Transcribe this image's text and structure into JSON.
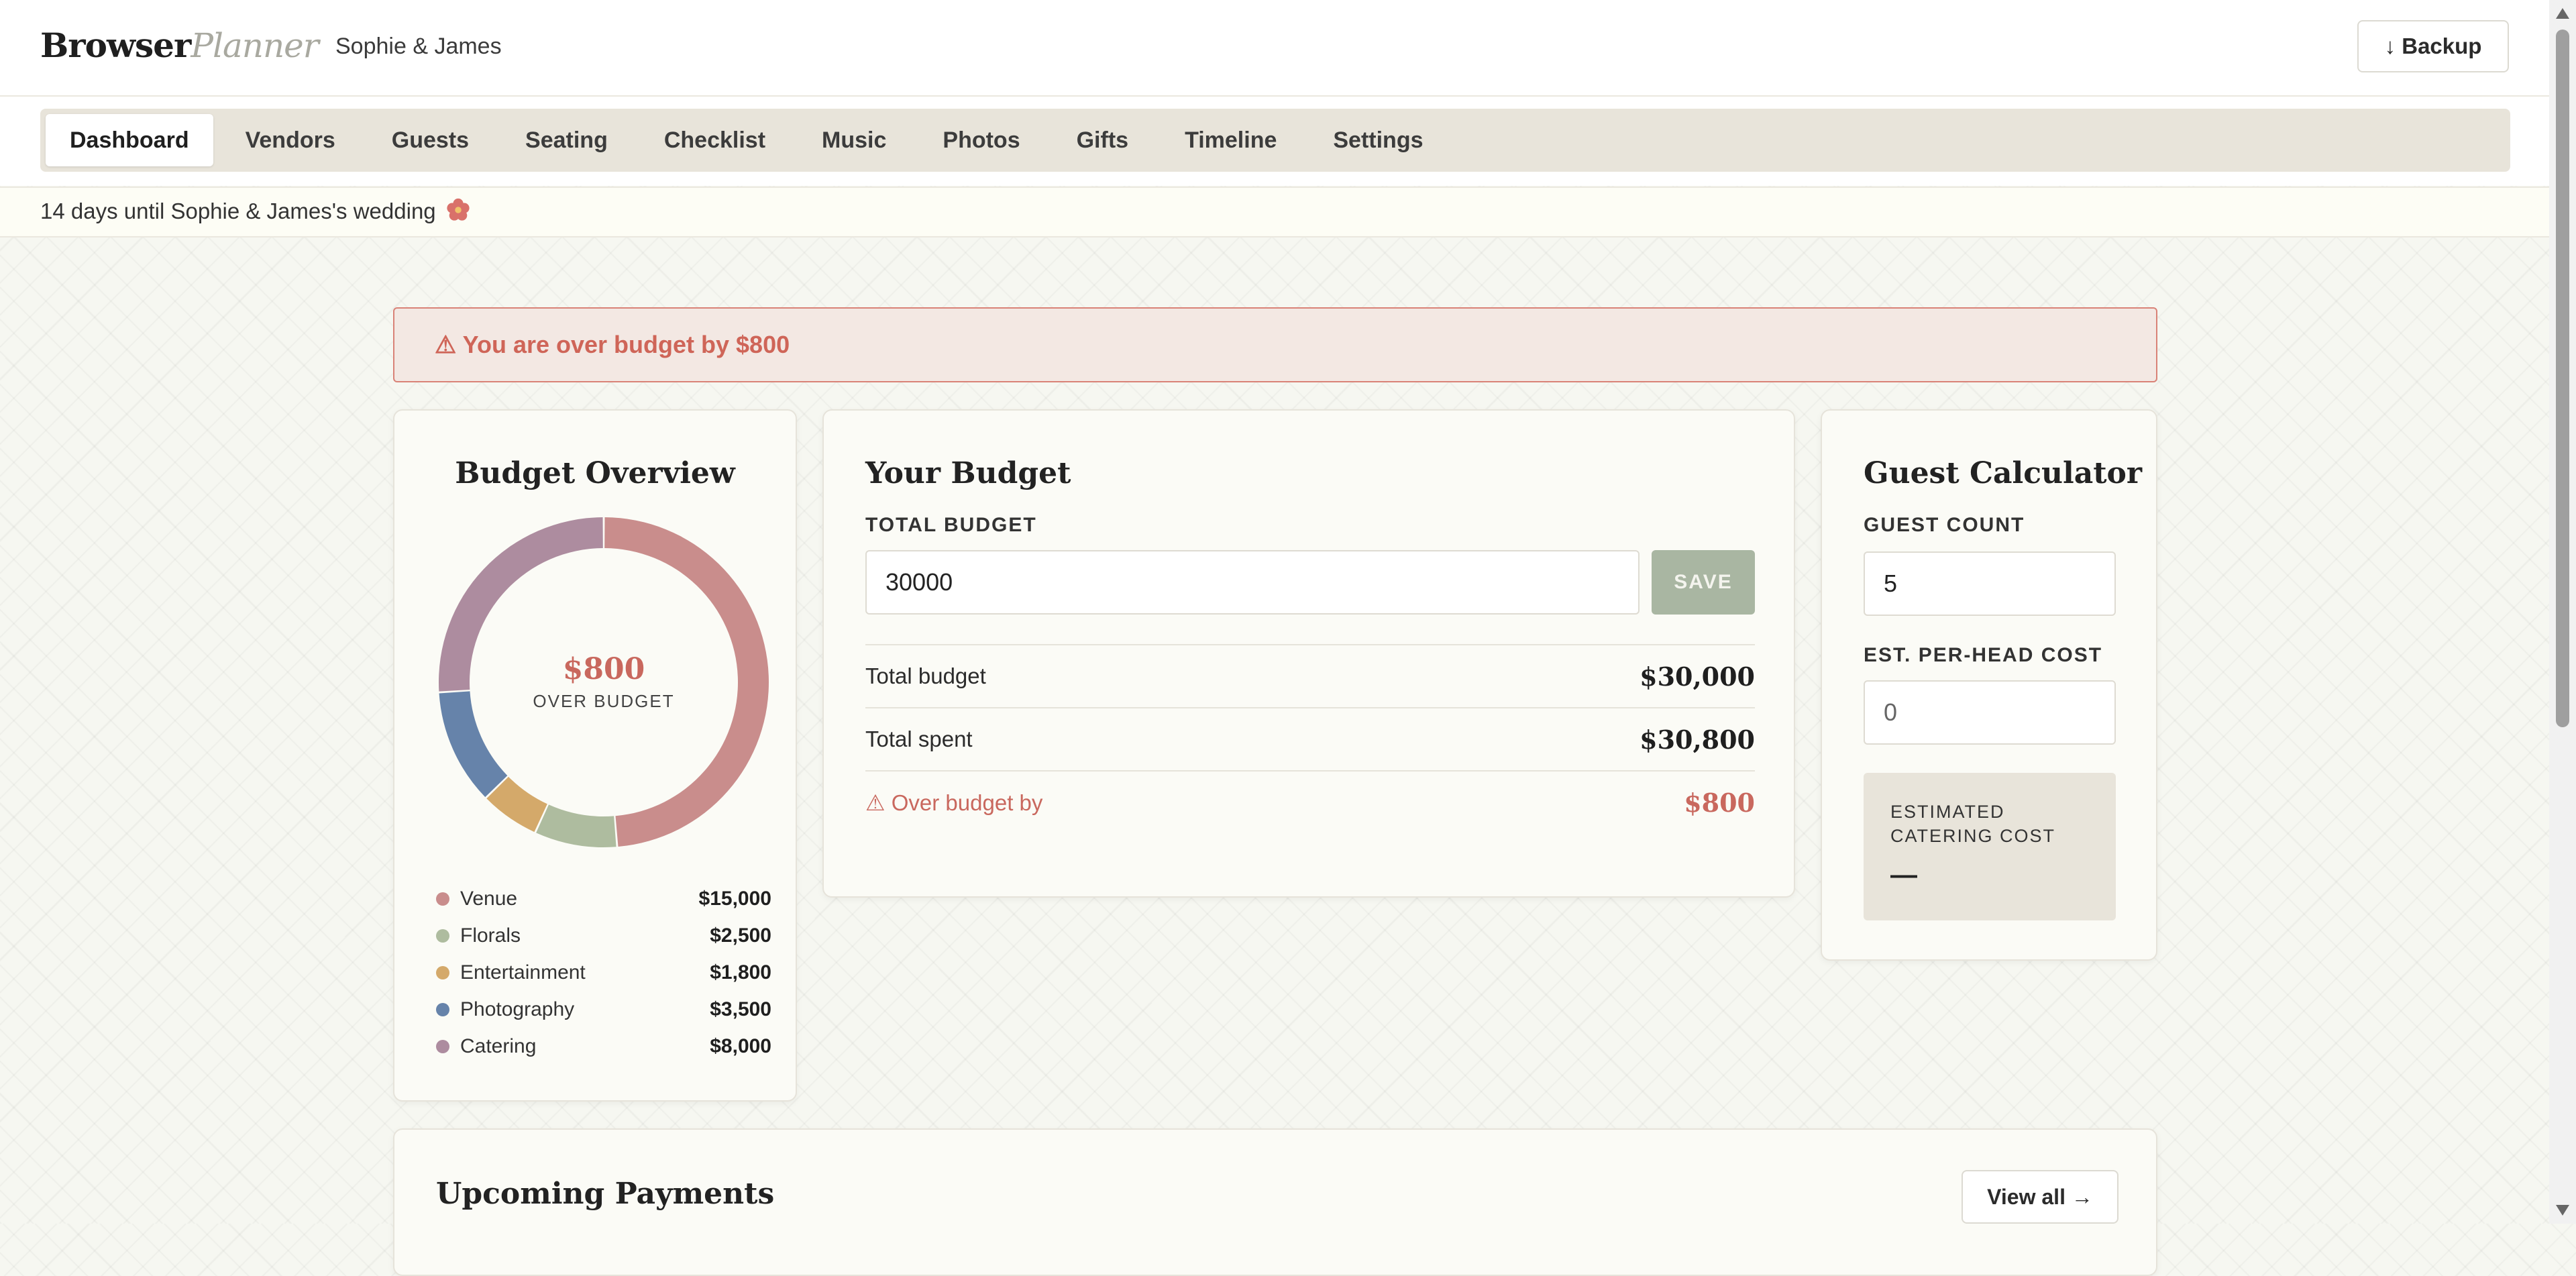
{
  "header": {
    "brand_bold": "Browser",
    "brand_light": "Planner",
    "couple": "Sophie & James",
    "backup_label": "↓ Backup"
  },
  "nav": {
    "tabs": [
      {
        "label": "Dashboard",
        "active": true
      },
      {
        "label": "Vendors"
      },
      {
        "label": "Guests"
      },
      {
        "label": "Seating"
      },
      {
        "label": "Checklist"
      },
      {
        "label": "Music"
      },
      {
        "label": "Photos"
      },
      {
        "label": "Gifts"
      },
      {
        "label": "Timeline"
      },
      {
        "label": "Settings"
      }
    ]
  },
  "countdown": {
    "text": "14 days until Sophie & James's wedding",
    "icon": "flower-icon"
  },
  "alert": {
    "text": "⚠ You are over budget by $800"
  },
  "overview": {
    "title": "Budget Overview",
    "center_value": "$800",
    "center_label": "OVER BUDGET",
    "items": [
      {
        "name": "Venue",
        "amount": "$15,000",
        "value": 15000,
        "color": "#c98d8c"
      },
      {
        "name": "Florals",
        "amount": "$2,500",
        "value": 2500,
        "color": "#aebc9f"
      },
      {
        "name": "Entertainment",
        "amount": "$1,800",
        "value": 1800,
        "color": "#d4a96a"
      },
      {
        "name": "Photography",
        "amount": "$3,500",
        "value": 3500,
        "color": "#6683aa"
      },
      {
        "name": "Catering",
        "amount": "$8,000",
        "value": 8000,
        "color": "#ad8c9f"
      }
    ]
  },
  "budget": {
    "title": "Your Budget",
    "total_label": "TOTAL BUDGET",
    "total_input": "30000",
    "save_label": "SAVE",
    "rows": [
      {
        "label": "Total budget",
        "value": "$30,000"
      },
      {
        "label": "Total spent",
        "value": "$30,800"
      },
      {
        "label": "⚠ Over budget by",
        "value": "$800"
      }
    ]
  },
  "guest_calc": {
    "title": "Guest Calculator",
    "count_label": "GUEST COUNT",
    "count_value": "5",
    "cost_label": "EST. PER-HEAD COST",
    "cost_value": "0",
    "est_label": "ESTIMATED CATERING COST",
    "est_value": "—"
  },
  "payments": {
    "title": "Upcoming Payments",
    "view_all": "View all →"
  },
  "colors": {
    "accent_red": "#cf6558",
    "save_green": "#a9b6a2",
    "nav_bg": "#e8e4da"
  }
}
